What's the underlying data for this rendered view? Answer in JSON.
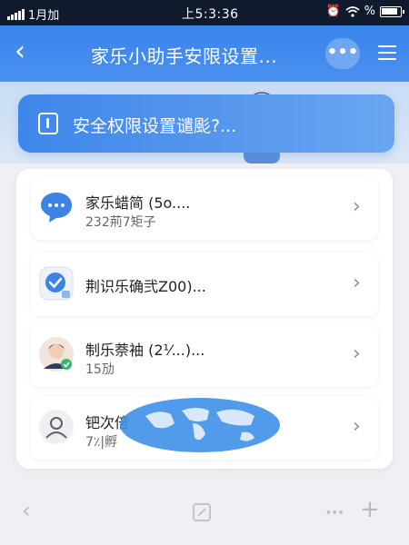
{
  "status_bar": {
    "carrier": "1月加",
    "time": "上5:3:36",
    "percent": "%"
  },
  "header": {
    "back_icon": "‹",
    "title": "家乐小助手安限设置...",
    "more_icon": "•••"
  },
  "banner": {
    "text": "安全权限设置谴颩?..."
  },
  "list": [
    {
      "title": "家乐蜡简 (5o....",
      "subtitle": "232荊7矩子",
      "icon": "chat-bubble-icon"
    },
    {
      "title": "荆识乐确弐Z00)...",
      "subtitle": "",
      "icon": "check-shield-icon"
    },
    {
      "title": "制乐萘袖 (2¹⁄...)...",
      "subtitle": "15劢",
      "icon": "avatar-verified-icon"
    },
    {
      "title": "钯次倍",
      "subtitle": "7٪|孵",
      "icon": "person-outline-icon"
    }
  ],
  "colors": {
    "header_blue": "#3a84ec",
    "banner_blue": "#3e86ea",
    "page_bg": "#eef0f4"
  }
}
